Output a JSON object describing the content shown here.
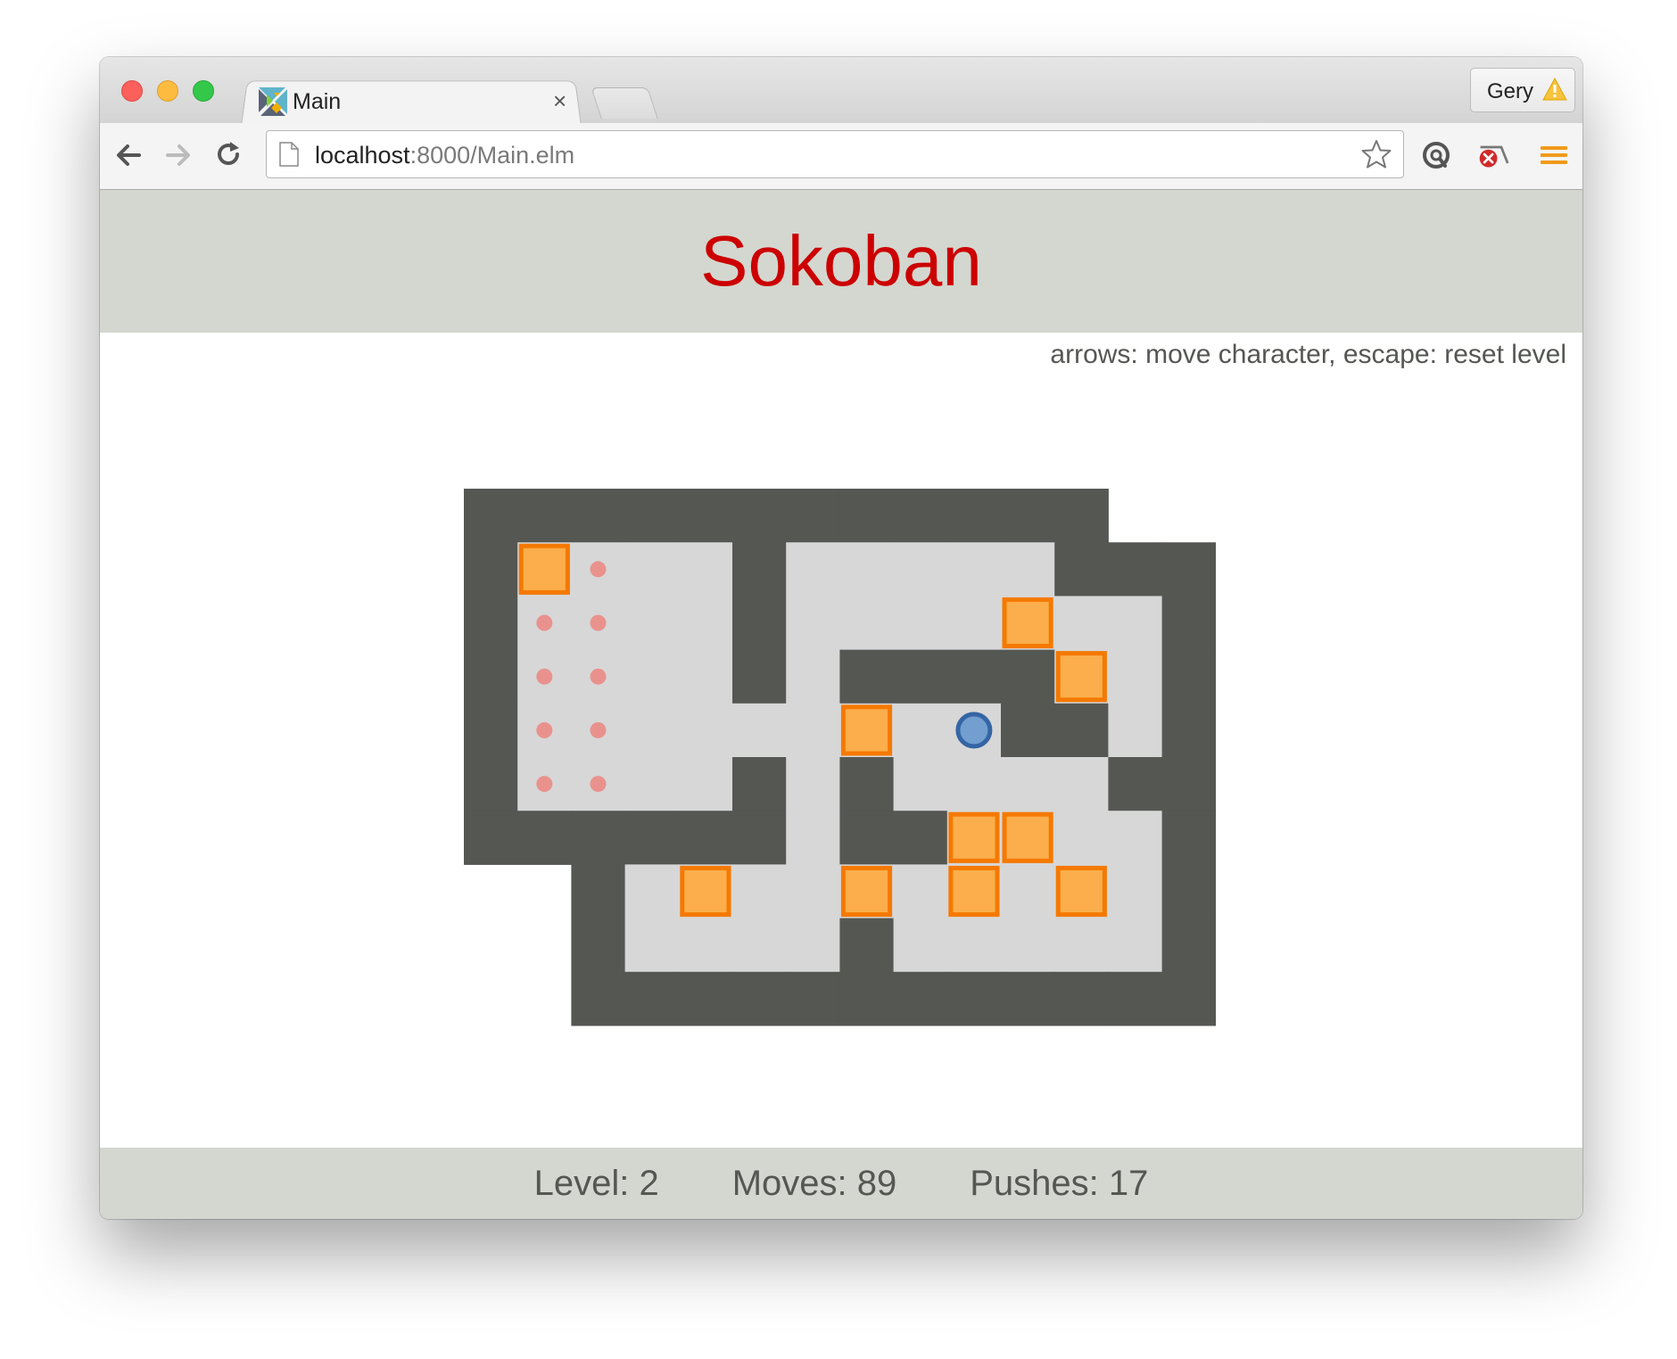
{
  "browser": {
    "tab_title": "Main",
    "tab_close": "×",
    "profile_name": "Gery",
    "url_host": "localhost",
    "url_rest": ":8000/Main.elm"
  },
  "game": {
    "title": "Sokoban",
    "instructions": "arrows: move character, escape: reset level",
    "stats": {
      "level": "Level: 2",
      "moves": "Moves: 89",
      "pushes": "Pushes: 17"
    },
    "colors": {
      "wall": "#555753",
      "floor": "#d7d7d7",
      "goal": "#e9928d",
      "box_fill": "#fbae4b",
      "box_border": "#f57900",
      "player_fill": "#729fcf",
      "player_border": "#3465a4",
      "header_bg": "#d3d7cf",
      "title": "#cc0000"
    },
    "map": [
      "############  ",
      "#$.  #     ###",
      "#..  #    $  #",
      "#..  # ####$ #",
      "#..    $ @## #",
      "#..  # #    ##",
      "###### ##$$  #",
      "  # $  $ $ $ #",
      "  #    #     #",
      "  ############"
    ],
    "legend": {
      "#": "wall",
      " ": "floor",
      ".": "goal",
      "$": "box",
      "@": "player"
    }
  }
}
